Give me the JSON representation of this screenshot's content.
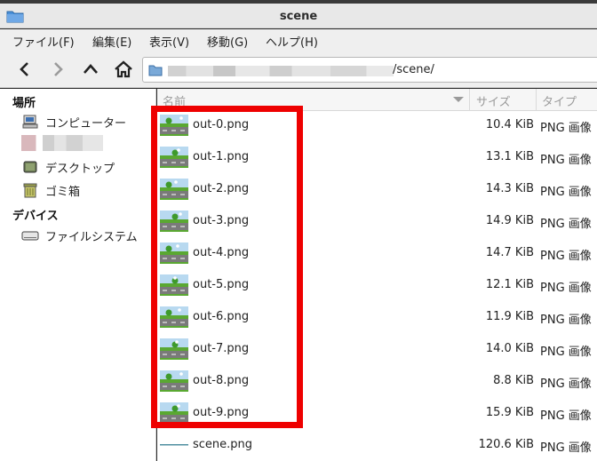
{
  "window": {
    "title": "scene"
  },
  "menu": [
    "ファイル(F)",
    "編集(E)",
    "表示(V)",
    "移動(G)",
    "ヘルプ(H)"
  ],
  "path": {
    "suffix": "/scene/"
  },
  "sidebar": {
    "places_header": "場所",
    "places": [
      {
        "label": "コンピューター",
        "icon": "computer-icon"
      },
      {
        "label": "デスクトップ",
        "icon": "desktop-icon"
      },
      {
        "label": "ゴミ箱",
        "icon": "trash-icon"
      }
    ],
    "devices_header": "デバイス",
    "devices": [
      {
        "label": "ファイルシステム",
        "icon": "drive-icon"
      }
    ]
  },
  "columns": {
    "name": "名前",
    "size": "サイズ",
    "type": "タイプ"
  },
  "files": [
    {
      "name": "out-0.png",
      "size": "10.4 KiB",
      "type": "PNG 画像"
    },
    {
      "name": "out-1.png",
      "size": "13.1 KiB",
      "type": "PNG 画像"
    },
    {
      "name": "out-2.png",
      "size": "14.3 KiB",
      "type": "PNG 画像"
    },
    {
      "name": "out-3.png",
      "size": "14.9 KiB",
      "type": "PNG 画像"
    },
    {
      "name": "out-4.png",
      "size": "14.7 KiB",
      "type": "PNG 画像"
    },
    {
      "name": "out-5.png",
      "size": "12.1 KiB",
      "type": "PNG 画像"
    },
    {
      "name": "out-6.png",
      "size": "11.9 KiB",
      "type": "PNG 画像"
    },
    {
      "name": "out-7.png",
      "size": "14.0 KiB",
      "type": "PNG 画像"
    },
    {
      "name": "out-8.png",
      "size": "8.8 KiB",
      "type": "PNG 画像"
    },
    {
      "name": "out-9.png",
      "size": "15.9 KiB",
      "type": "PNG 画像"
    },
    {
      "name": "scene.png",
      "size": "120.6 KiB",
      "type": "PNG 画像"
    }
  ],
  "colors": {
    "highlight": "#ee0000",
    "sky": "#b8d9f0",
    "grass": "#5aa832",
    "road": "#7a7a7a"
  }
}
